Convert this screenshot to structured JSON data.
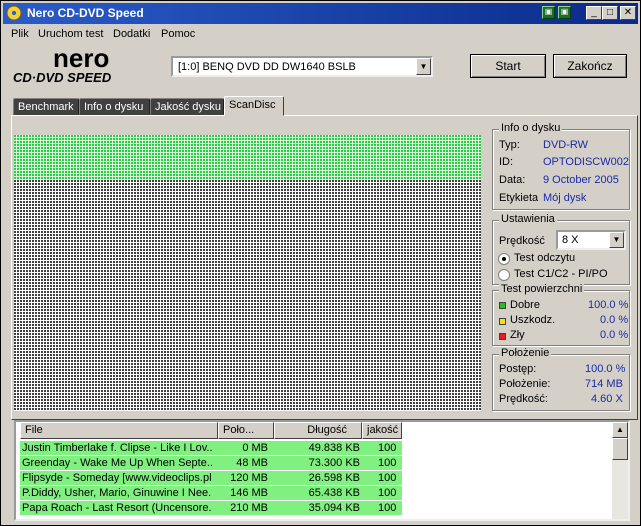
{
  "window": {
    "title": "Nero CD-DVD Speed",
    "minimize": "_",
    "restore": "□",
    "close": "✕",
    "small_btn1": "▣",
    "small_btn2": "▣"
  },
  "menu": [
    "Plik",
    "Uruchom test",
    "Dodatki",
    "Pomoc"
  ],
  "logo": {
    "top": "nero",
    "bottom": "CD·DVD SPEED"
  },
  "drive": {
    "selected": "[1:0]   BENQ DVD DD DW1640 BSLB"
  },
  "buttons": {
    "start": "Start",
    "stop": "Zakończ"
  },
  "tabs": [
    {
      "label": "Benchmark"
    },
    {
      "label": "Info o dysku"
    },
    {
      "label": "Jakość dysku"
    },
    {
      "label": "ScanDisc",
      "active": true
    }
  ],
  "disc_info": {
    "title": "Info o dysku",
    "rows": [
      {
        "key": "Typ:",
        "value": "DVD-RW"
      },
      {
        "key": "ID:",
        "value": "OPTODISCW002"
      },
      {
        "key": "Data:",
        "value": "9 October 2005"
      },
      {
        "key": "Etykieta",
        "value": "Mój dysk"
      }
    ]
  },
  "settings": {
    "title": "Ustawienia",
    "speed_label": "Prędkość",
    "speed_value": "8 X",
    "radio_read": "Test odczytu",
    "radio_c1c2": "Test C1/C2 - PI/PO"
  },
  "surface": {
    "title": "Test powierzchni",
    "rows": [
      {
        "label": "Dobre",
        "value": "100.0 %",
        "color": "#20c020"
      },
      {
        "label": "Uszkodz.",
        "value": "0.0 %",
        "color": "#f0e020"
      },
      {
        "label": "Zły",
        "value": "0.0 %",
        "color": "#e02020"
      }
    ]
  },
  "position": {
    "title": "Położenie",
    "rows": [
      {
        "key": "Postęp:",
        "value": "100.0 %"
      },
      {
        "key": "Położenie:",
        "value": "714 MB"
      },
      {
        "key": "Prędkość:",
        "value": "4.60 X"
      }
    ]
  },
  "scan": {
    "good_fraction": 0.16,
    "good_color": "#2ec84a"
  },
  "list": {
    "headers": [
      "File",
      "Poło...",
      "Długość",
      "jakość"
    ],
    "rows": [
      [
        "Justin Timberlake f. Clipse - Like I Lov...",
        "0 MB",
        "49.838 KB",
        "100"
      ],
      [
        "Greenday - Wake Me Up When Septe...",
        "48 MB",
        "73.300 KB",
        "100"
      ],
      [
        "Flipsyde - Someday [www.videoclips.pl...",
        "120 MB",
        "26.598 KB",
        "100"
      ],
      [
        "P.Diddy, Usher, Mario, Ginuwine I Nee...",
        "146 MB",
        "65.438 KB",
        "100"
      ],
      [
        "Papa Roach - Last Resort (Uncensore...",
        "210 MB",
        "35.094 KB",
        "100"
      ]
    ]
  }
}
